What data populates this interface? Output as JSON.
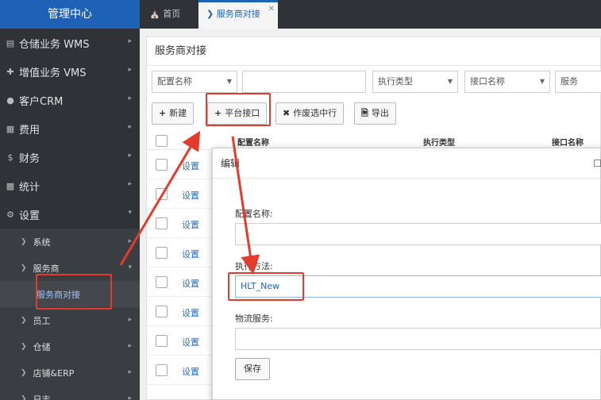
{
  "sidebar": {
    "brand": "管理中心",
    "items": [
      {
        "icon": "warehouse-icon",
        "label": "仓储业务 WMS"
      },
      {
        "icon": "plus-icon",
        "label": "增值业务 VMS"
      },
      {
        "icon": "users-icon",
        "label": "客户CRM"
      },
      {
        "icon": "table-icon",
        "label": "费用"
      },
      {
        "icon": "dollar-icon",
        "label": "财务"
      },
      {
        "icon": "chart-icon",
        "label": "统计"
      },
      {
        "icon": "gear-icon",
        "label": "设置"
      }
    ],
    "sub_items": [
      {
        "label": "系统"
      },
      {
        "label": "服务商"
      },
      {
        "label": "服务商对接"
      },
      {
        "label": "员工"
      },
      {
        "label": "仓储"
      },
      {
        "label": "店铺&ERP"
      },
      {
        "label": "日志"
      }
    ]
  },
  "tabs": {
    "home": "首页",
    "active": "服务商对接"
  },
  "panel": {
    "title": "服务商对接",
    "filters": {
      "config_name": "配置名称",
      "exec_type": "执行类型",
      "interface_name": "接口名称",
      "service": "服务"
    },
    "toolbar": {
      "new": "新建",
      "platform_interface": "平台接口",
      "void_selected": "作废选中行",
      "export": "导出"
    },
    "table": {
      "columns": [
        "配置名称",
        "执行类型",
        "接口名称"
      ],
      "row_action": "设置",
      "row_count": 8
    }
  },
  "modal": {
    "title": "编辑",
    "fields": {
      "config_name_label": "配置名称:",
      "config_name_value": "",
      "exec_method_label": "执行方法:",
      "exec_method_value": "HLT_New",
      "logistics_label": "物流服务:",
      "logistics_value": ""
    },
    "save": "保存"
  },
  "colors": {
    "brand_blue": "#1e62b8",
    "sidebar_bg": "#2f3237",
    "annotation_red": "#e53b2c",
    "link_blue": "#2a6ebd"
  }
}
